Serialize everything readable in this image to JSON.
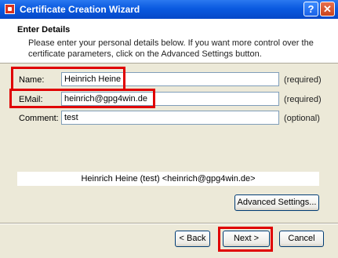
{
  "window": {
    "title": "Certificate Creation Wizard",
    "help_label": "?",
    "close_label": "✕"
  },
  "header": {
    "title": "Enter Details",
    "description": "Please enter your personal details below. If you want more control over the certificate parameters, click on the Advanced Settings button."
  },
  "form": {
    "name": {
      "label": "Name:",
      "value": "Heinrich Heine",
      "note": "(required)"
    },
    "email": {
      "label": "EMail:",
      "value": "heinrich@gpg4win.de",
      "note": "(required)"
    },
    "comment": {
      "label": "Comment:",
      "value": "test",
      "note": "(optional)"
    }
  },
  "preview": "Heinrich Heine (test) <heinrich@gpg4win.de>",
  "buttons": {
    "advanced": "Advanced Settings...",
    "back": "< Back",
    "next": "Next >",
    "cancel": "Cancel"
  },
  "colors": {
    "highlight": "#e00000",
    "titlebar": "#0a5ae0",
    "dialog_bg": "#ece9d8"
  }
}
